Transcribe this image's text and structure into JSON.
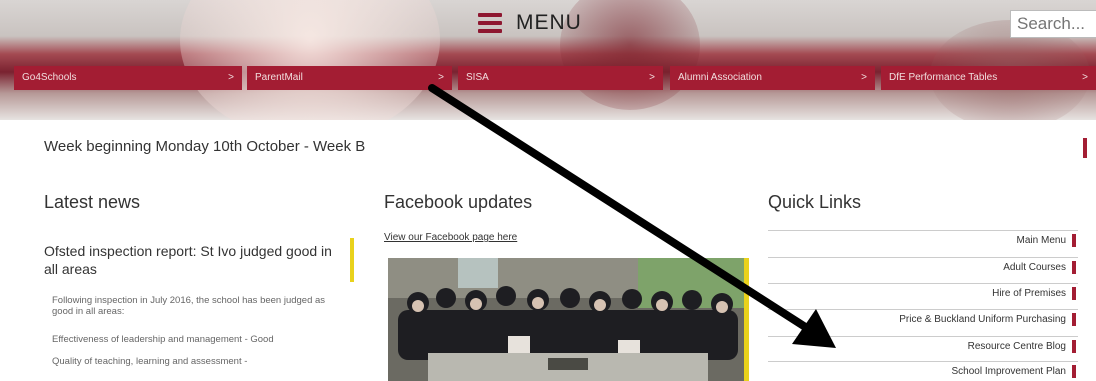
{
  "header": {
    "menu_label": "MENU",
    "search_placeholder": "Search..."
  },
  "quick_bar": [
    {
      "label": "Go4Schools"
    },
    {
      "label": "ParentMail"
    },
    {
      "label": "SISA"
    },
    {
      "label": "Alumni Association"
    },
    {
      "label": "DfE Performance Tables"
    }
  ],
  "week_banner": "Week beginning Monday 10th October - Week B",
  "latest_news": {
    "heading": "Latest news",
    "item_title": "Ofsted inspection report: St Ivo judged good in all areas",
    "p1": "Following inspection in July 2016, the school has been judged as good in all areas:",
    "p2": "Effectiveness of leadership and management - Good",
    "p3": "Quality of teaching, learning and assessment -"
  },
  "facebook": {
    "heading": "Facebook updates",
    "link": "View our Facebook page here"
  },
  "quick_links": {
    "heading": "Quick Links",
    "items": [
      "Main Menu",
      "Adult Courses",
      "Hire of Premises",
      "Price & Buckland Uniform Purchasing",
      "Resource Centre Blog",
      "School Improvement Plan"
    ]
  },
  "colors": {
    "brand": "#a31d33",
    "accent": "#e9d21c"
  }
}
